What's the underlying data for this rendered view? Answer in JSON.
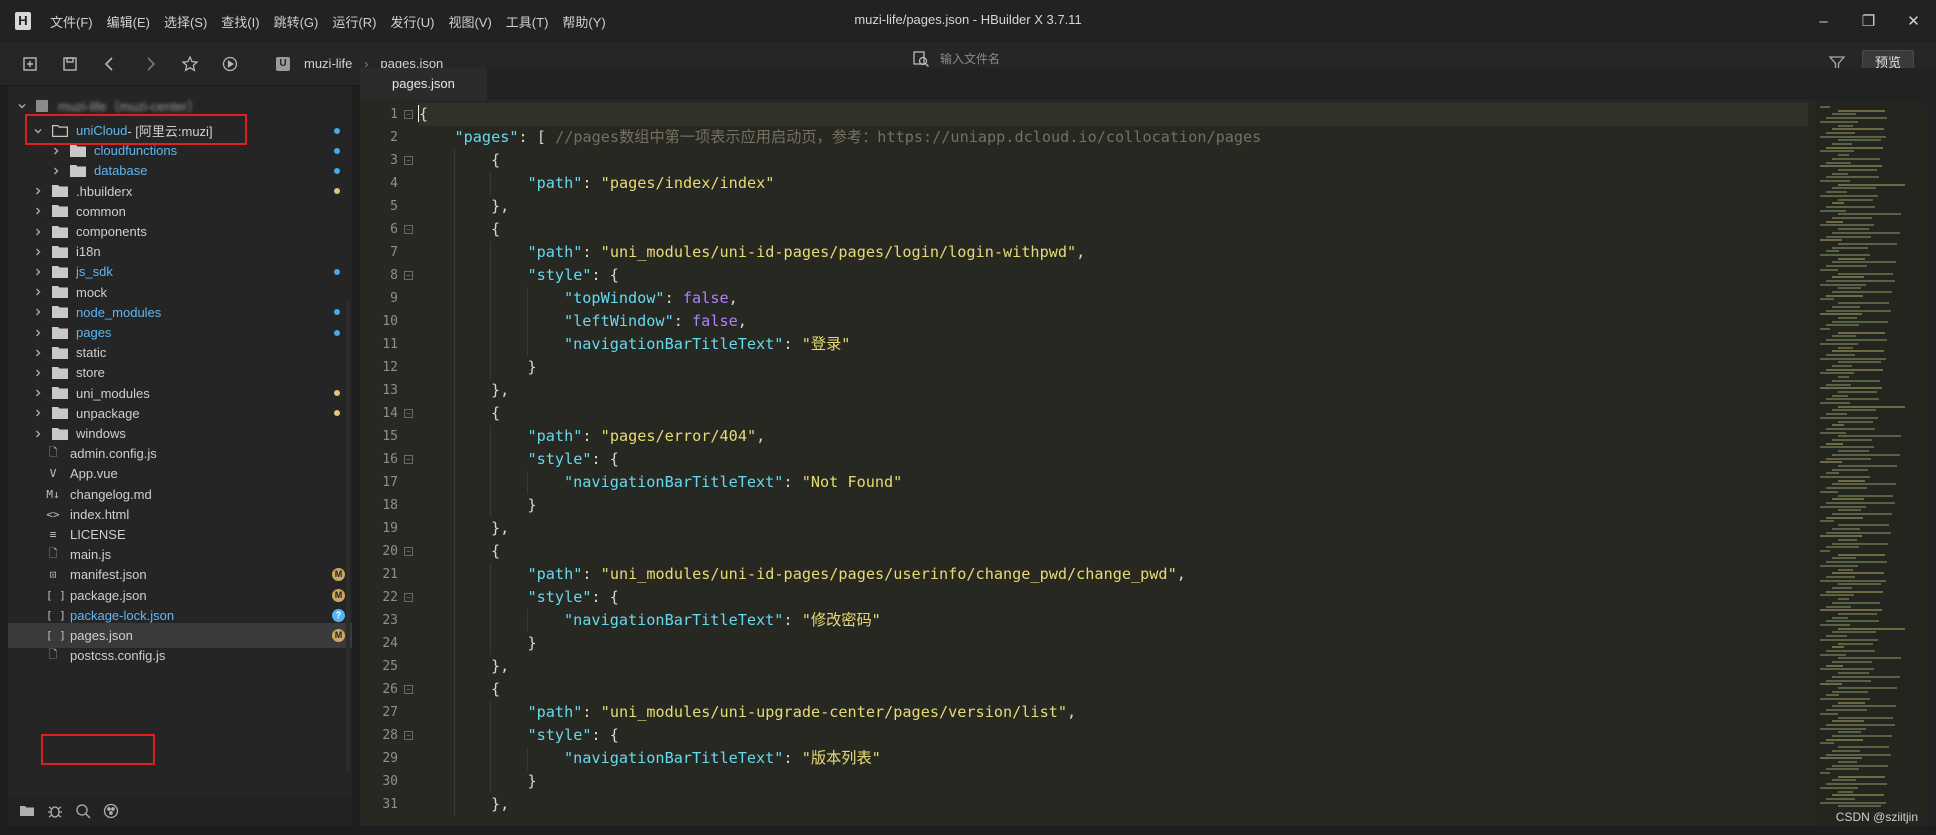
{
  "app": {
    "logo": "H",
    "window_title": "muzi-life/pages.json - HBuilder X 3.7.11",
    "menu": [
      "文件(F)",
      "编辑(E)",
      "选择(S)",
      "查找(I)",
      "跳转(G)",
      "运行(R)",
      "发行(U)",
      "视图(V)",
      "工具(T)",
      "帮助(Y)"
    ]
  },
  "toolbar": {
    "breadcrumb_logo": "U",
    "breadcrumb": [
      "muzi-life",
      "pages.json"
    ],
    "search_placeholder": "输入文件名",
    "preview_label": "预览"
  },
  "sidebar": {
    "project_name": "muzi-life（muzi-center）",
    "items": [
      {
        "label": "uniCloud",
        "suffix": " - [阿里云:muzi]",
        "type": "folder",
        "expanded": true,
        "level": 1,
        "status": "blue-dot",
        "color": "blue"
      },
      {
        "label": "cloudfunctions",
        "type": "folder",
        "level": 2,
        "status": "blue-dot",
        "color": "blue"
      },
      {
        "label": "database",
        "type": "folder",
        "level": 2,
        "status": "blue-dot",
        "color": "blue"
      },
      {
        "label": ".hbuilderx",
        "type": "folder",
        "level": 1,
        "status": "yellow-dot"
      },
      {
        "label": "common",
        "type": "folder",
        "level": 1
      },
      {
        "label": "components",
        "type": "folder",
        "level": 1
      },
      {
        "label": "i18n",
        "type": "folder",
        "level": 1
      },
      {
        "label": "js_sdk",
        "type": "folder",
        "level": 1,
        "status": "blue-dot",
        "color": "blue"
      },
      {
        "label": "mock",
        "type": "folder",
        "level": 1
      },
      {
        "label": "node_modules",
        "type": "folder",
        "level": 1,
        "status": "blue-dot",
        "color": "blue"
      },
      {
        "label": "pages",
        "type": "folder",
        "level": 1,
        "status": "blue-dot",
        "color": "blue"
      },
      {
        "label": "static",
        "type": "folder",
        "level": 1
      },
      {
        "label": "store",
        "type": "folder",
        "level": 1
      },
      {
        "label": "uni_modules",
        "type": "folder",
        "level": 1,
        "status": "yellow-dot"
      },
      {
        "label": "unpackage",
        "type": "folder",
        "level": 1,
        "status": "yellow-dot"
      },
      {
        "label": "windows",
        "type": "folder",
        "level": 1
      },
      {
        "label": "admin.config.js",
        "type": "file",
        "icon": "js",
        "level": 1
      },
      {
        "label": "App.vue",
        "type": "file",
        "icon": "vue",
        "level": 1
      },
      {
        "label": "changelog.md",
        "type": "file",
        "icon": "md",
        "level": 1
      },
      {
        "label": "index.html",
        "type": "file",
        "icon": "html",
        "level": 1
      },
      {
        "label": "LICENSE",
        "type": "file",
        "icon": "txt",
        "level": 1
      },
      {
        "label": "main.js",
        "type": "file",
        "icon": "js",
        "level": 1
      },
      {
        "label": "manifest.json",
        "type": "file",
        "icon": "manifest",
        "level": 1,
        "status": "M"
      },
      {
        "label": "package.json",
        "type": "file",
        "icon": "json",
        "level": 1,
        "status": "M"
      },
      {
        "label": "package-lock.json",
        "type": "file",
        "icon": "json",
        "level": 1,
        "status": "?",
        "color": "blue"
      },
      {
        "label": "pages.json",
        "type": "file",
        "icon": "json",
        "level": 1,
        "status": "M",
        "selected": true
      },
      {
        "label": "postcss.config.js",
        "type": "file",
        "icon": "js",
        "level": 1
      }
    ]
  },
  "editor": {
    "tab_label": "pages.json",
    "line_numbers": [
      "1",
      "2",
      "3",
      "4",
      "5",
      "6",
      "7",
      "8",
      "9",
      "10",
      "11",
      "12",
      "13",
      "14",
      "15",
      "16",
      "17",
      "18",
      "19",
      "20",
      "21",
      "22",
      "23",
      "24",
      "25",
      "26",
      "27",
      "28",
      "29",
      "30",
      "31"
    ],
    "lines": [
      {
        "i": 0,
        "t": [
          [
            "p",
            "{"
          ]
        ]
      },
      {
        "i": 1,
        "t": [
          [
            "k",
            "\"pages\""
          ],
          [
            "p",
            ": [ "
          ],
          [
            "c",
            "//pages数组中第一项表示应用启动页，参考：https://uniapp.dcloud.io/collocation/pages"
          ]
        ]
      },
      {
        "i": 2,
        "t": [
          [
            "p",
            "{"
          ]
        ]
      },
      {
        "i": 3,
        "t": [
          [
            "k",
            "\"path\""
          ],
          [
            "p",
            ": "
          ],
          [
            "s",
            "\"pages/index/index\""
          ]
        ]
      },
      {
        "i": 2,
        "t": [
          [
            "p",
            "},"
          ]
        ]
      },
      {
        "i": 2,
        "t": [
          [
            "p",
            "{"
          ]
        ]
      },
      {
        "i": 3,
        "t": [
          [
            "k",
            "\"path\""
          ],
          [
            "p",
            ": "
          ],
          [
            "s",
            "\"uni_modules/uni-id-pages/pages/login/login-withpwd\""
          ],
          [
            "p",
            ","
          ]
        ]
      },
      {
        "i": 3,
        "t": [
          [
            "k",
            "\"style\""
          ],
          [
            "p",
            ": {"
          ]
        ]
      },
      {
        "i": 4,
        "t": [
          [
            "k",
            "\"topWindow\""
          ],
          [
            "p",
            ": "
          ],
          [
            "b",
            "false"
          ],
          [
            "p",
            ","
          ]
        ]
      },
      {
        "i": 4,
        "t": [
          [
            "k",
            "\"leftWindow\""
          ],
          [
            "p",
            ": "
          ],
          [
            "b",
            "false"
          ],
          [
            "p",
            ","
          ]
        ]
      },
      {
        "i": 4,
        "t": [
          [
            "k",
            "\"navigationBarTitleText\""
          ],
          [
            "p",
            ": "
          ],
          [
            "s",
            "\"登录\""
          ]
        ]
      },
      {
        "i": 3,
        "t": [
          [
            "p",
            "}"
          ]
        ]
      },
      {
        "i": 2,
        "t": [
          [
            "p",
            "},"
          ]
        ]
      },
      {
        "i": 2,
        "t": [
          [
            "p",
            "{"
          ]
        ]
      },
      {
        "i": 3,
        "t": [
          [
            "k",
            "\"path\""
          ],
          [
            "p",
            ": "
          ],
          [
            "s",
            "\"pages/error/404\""
          ],
          [
            "p",
            ","
          ]
        ]
      },
      {
        "i": 3,
        "t": [
          [
            "k",
            "\"style\""
          ],
          [
            "p",
            ": {"
          ]
        ]
      },
      {
        "i": 4,
        "t": [
          [
            "k",
            "\"navigationBarTitleText\""
          ],
          [
            "p",
            ": "
          ],
          [
            "s",
            "\"Not Found\""
          ]
        ]
      },
      {
        "i": 3,
        "t": [
          [
            "p",
            "}"
          ]
        ]
      },
      {
        "i": 2,
        "t": [
          [
            "p",
            "},"
          ]
        ]
      },
      {
        "i": 2,
        "t": [
          [
            "p",
            "{"
          ]
        ]
      },
      {
        "i": 3,
        "t": [
          [
            "k",
            "\"path\""
          ],
          [
            "p",
            ": "
          ],
          [
            "s",
            "\"uni_modules/uni-id-pages/pages/userinfo/change_pwd/change_pwd\""
          ],
          [
            "p",
            ","
          ]
        ]
      },
      {
        "i": 3,
        "t": [
          [
            "k",
            "\"style\""
          ],
          [
            "p",
            ": {"
          ]
        ]
      },
      {
        "i": 4,
        "t": [
          [
            "k",
            "\"navigationBarTitleText\""
          ],
          [
            "p",
            ": "
          ],
          [
            "s",
            "\"修改密码\""
          ]
        ]
      },
      {
        "i": 3,
        "t": [
          [
            "p",
            "}"
          ]
        ]
      },
      {
        "i": 2,
        "t": [
          [
            "p",
            "},"
          ]
        ]
      },
      {
        "i": 2,
        "t": [
          [
            "p",
            "{"
          ]
        ]
      },
      {
        "i": 3,
        "t": [
          [
            "k",
            "\"path\""
          ],
          [
            "p",
            ": "
          ],
          [
            "s",
            "\"uni_modules/uni-upgrade-center/pages/version/list\""
          ],
          [
            "p",
            ","
          ]
        ]
      },
      {
        "i": 3,
        "t": [
          [
            "k",
            "\"style\""
          ],
          [
            "p",
            ": {"
          ]
        ]
      },
      {
        "i": 4,
        "t": [
          [
            "k",
            "\"navigationBarTitleText\""
          ],
          [
            "p",
            ": "
          ],
          [
            "s",
            "\"版本列表\""
          ]
        ]
      },
      {
        "i": 3,
        "t": [
          [
            "p",
            "}"
          ]
        ]
      },
      {
        "i": 2,
        "t": [
          [
            "p",
            "},"
          ]
        ]
      }
    ],
    "fold_lines": [
      1,
      3,
      6,
      8,
      14,
      16,
      20,
      22,
      26,
      28
    ]
  },
  "watermark": "CSDN @sziitjin",
  "colors": {
    "keyword": "#66d9ef",
    "string": "#e6db74",
    "comment": "#75715e",
    "boolean": "#ae81ff",
    "highlight_box": "#e02020",
    "modified_badge": "#c9a862",
    "untracked_badge": "#58b4ee"
  }
}
